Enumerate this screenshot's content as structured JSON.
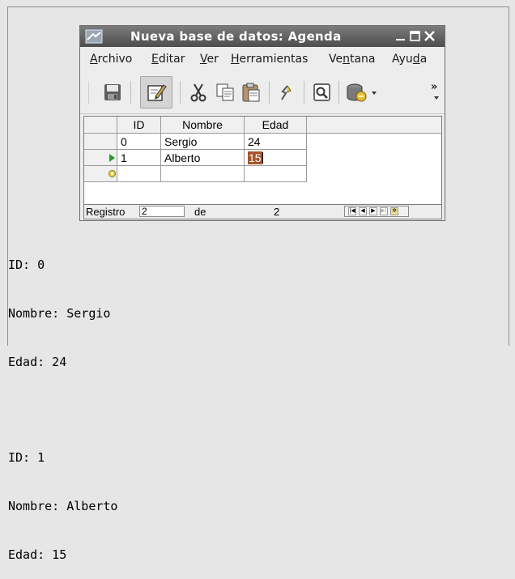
{
  "window": {
    "title": "Nueva base de datos: Agenda"
  },
  "menu": [
    {
      "label": "Archivo",
      "mnemonic_index": 0
    },
    {
      "label": "Editar",
      "mnemonic_index": 0
    },
    {
      "label": "Ver",
      "mnemonic_index": 0
    },
    {
      "label": "Herramientas",
      "mnemonic_index": 0
    },
    {
      "label": "Ventana",
      "mnemonic_index": 2
    },
    {
      "label": "Ayuda",
      "mnemonic_index": 3
    }
  ],
  "toolbar": {
    "icons": [
      "save-icon",
      "edit-icon",
      "cut-icon",
      "copy-icon",
      "paste-icon",
      "undo-icon",
      "find-icon",
      "data-source-icon"
    ],
    "overflow_label": "»"
  },
  "grid": {
    "columns": [
      "ID",
      "Nombre",
      "Edad"
    ],
    "rows": [
      {
        "id": "0",
        "nombre": "Sergio",
        "edad": "24"
      },
      {
        "id": "1",
        "nombre": "Alberto",
        "edad": "15"
      }
    ],
    "current_row": 1,
    "new_row_marker": "new-record-icon"
  },
  "navigation": {
    "label": "Registro",
    "current": "2",
    "of_label": "de",
    "total": "2"
  },
  "console": {
    "lines": [
      "ID: 0",
      "Nombre: Sergio",
      "Edad: 24",
      "",
      "ID: 1",
      "Nombre: Alberto",
      "Edad: 15"
    ]
  },
  "colors": {
    "selection": "#a8542c",
    "titlebar": "#5a5a5a"
  }
}
